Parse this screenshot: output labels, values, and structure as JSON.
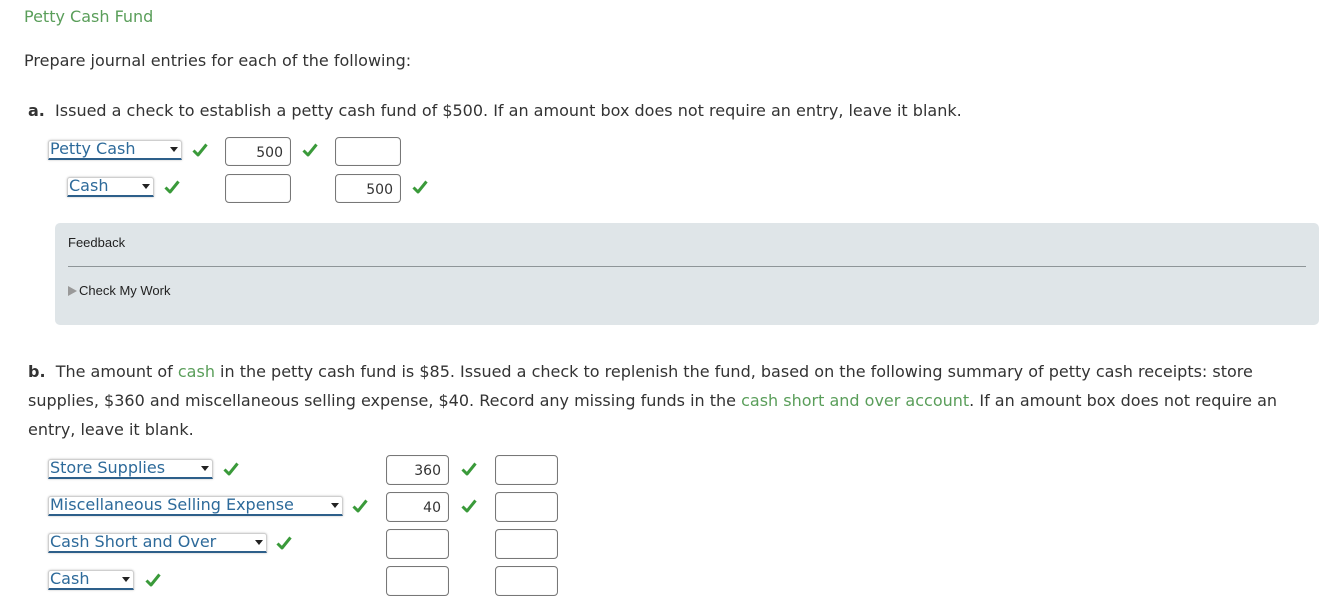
{
  "title": "Petty Cash Fund",
  "intro": "Prepare journal entries for each of the following:",
  "colors": {
    "accent_green": "#5a9e5a",
    "link_blue": "#2d6a9a",
    "check_green": "#3a9a3a",
    "feedback_bg": "#dfe5e8"
  },
  "part_a": {
    "letter": "a.",
    "text": "Issued a check to establish a petty cash fund of $500. If an amount box does not require an entry, leave it blank.",
    "rows": [
      {
        "account": "Petty Cash",
        "account_correct": true,
        "debit": "500",
        "debit_correct": true,
        "credit": "",
        "credit_correct": false
      },
      {
        "account": "Cash",
        "account_correct": true,
        "debit": "",
        "debit_correct": false,
        "credit": "500",
        "credit_correct": true
      }
    ]
  },
  "feedback": {
    "title": "Feedback",
    "toggle_label": "Check My Work"
  },
  "part_b": {
    "letter": "b.",
    "text_1": "The amount of ",
    "link_1": "cash",
    "text_2": " in the petty cash fund is $85. Issued a check to replenish the fund, based on the following summary of petty cash receipts: store supplies, $360 and miscellaneous selling expense, $40. Record any missing funds in the ",
    "link_2": "cash short and over account",
    "text_3": ". If an amount box does not require an entry, leave it blank.",
    "rows": [
      {
        "account": "Store Supplies",
        "account_correct": true,
        "debit": "360",
        "debit_correct": true,
        "credit": ""
      },
      {
        "account": "Miscellaneous Selling Expense",
        "account_correct": true,
        "debit": "40",
        "debit_correct": true,
        "credit": ""
      },
      {
        "account": "Cash Short and Over",
        "account_correct": true,
        "debit": "",
        "debit_correct": false,
        "credit": ""
      },
      {
        "account": "Cash",
        "account_correct": true,
        "debit": "",
        "debit_correct": false,
        "credit": ""
      }
    ]
  },
  "icons": {
    "check": "checkmark-icon",
    "dropdown": "chevron-down-icon",
    "expand": "triangle-right-icon"
  }
}
